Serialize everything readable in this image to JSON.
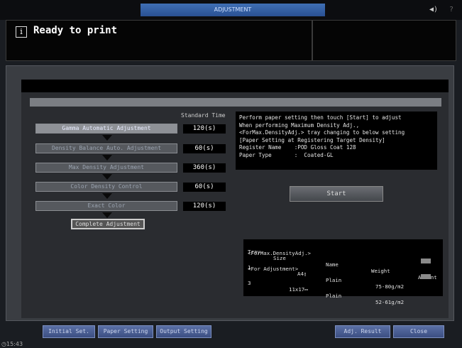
{
  "header": {
    "tab_title": "ADJUSTMENT",
    "volume_icon": "speaker-icon",
    "help_label": "?"
  },
  "message": {
    "icon_label": "i",
    "text": "Ready to print"
  },
  "steps_header": "Standard Time",
  "steps": [
    {
      "label": "Gamma Automatic Adjustment",
      "time": "120(s)"
    },
    {
      "label": "Density Balance Auto. Adjustment",
      "time": "60(s)"
    },
    {
      "label": "Max Density Adjustment",
      "time": "360(s)"
    },
    {
      "label": "Color Density Control",
      "time": "60(s)"
    },
    {
      "label": "Exact Color",
      "time": "120(s)"
    }
  ],
  "complete_label": "Complete Adjustment",
  "description": {
    "line1": "Perform paper setting then touch [Start] to adjust",
    "line2": "When performing Maximum Density Adj.,",
    "line3": "<ForMax.DensityAdj.> tray changing to below setting",
    "line4": "[Paper Setting at Registering Target Density]",
    "line5": "Register Name    :POD Gloss Coat 128",
    "line6": "Paper Type       :  Coated-GL"
  },
  "start_label": "Start",
  "tray_table": {
    "headers": {
      "tray": "Tray",
      "size": "Size",
      "name": "Name",
      "weight": "Weight",
      "amount": "Amount"
    },
    "group1": "<ForMax.DensityAdj.>",
    "row1": {
      "tray": "1",
      "size": "A4▯",
      "name": "Plain",
      "weight": "75-80g/m2"
    },
    "group2": "<For Adjustment>",
    "row2": {
      "tray": "3",
      "size": "11x17▭",
      "name": "Plain",
      "weight": "52-61g/m2"
    }
  },
  "bottom": {
    "initial_set": "Initial Set.",
    "paper_setting": "Paper Setting",
    "output_setting": "Output Setting",
    "adj_result": "Adj. Result",
    "close": "Close",
    "clock": "15:43"
  },
  "colors": {
    "accent_blue": "#3f6fb5",
    "panel": "#2a2c30",
    "button_blue": "#4a5f95"
  }
}
